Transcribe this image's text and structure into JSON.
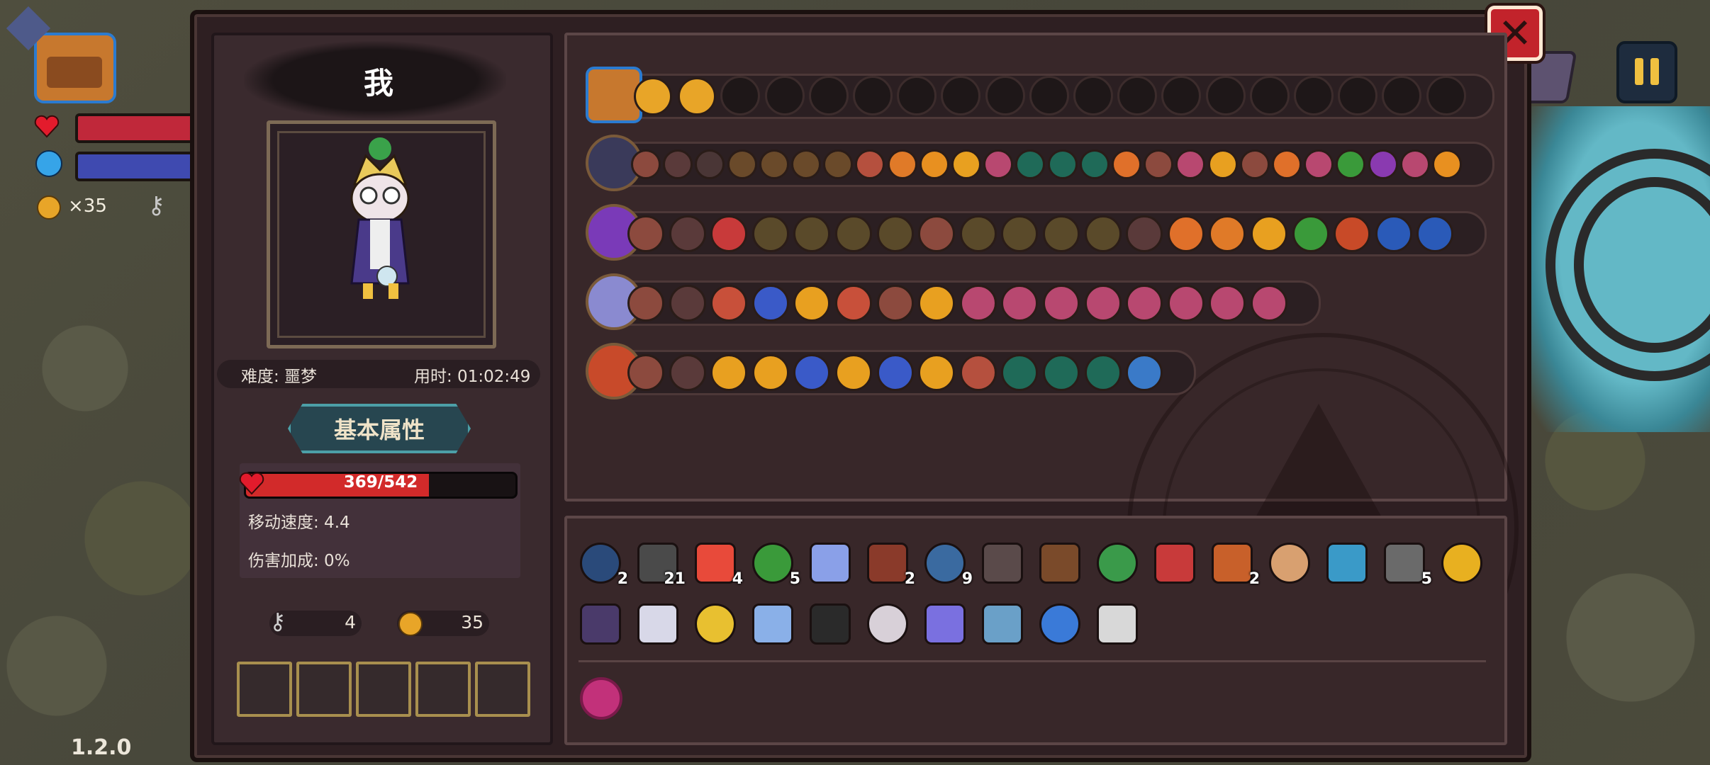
{
  "hud": {
    "coins_label": "×35",
    "version": "1.2.0"
  },
  "panel": {
    "player_name": "我",
    "difficulty": "难度: 噩梦",
    "time": "用时: 01:02:49",
    "attr_title": "基本属性",
    "hp_text": "369/542",
    "hp_fraction": 0.68,
    "move_speed": "移动速度: 4.4",
    "damage_bonus": "伤害加成: 0%",
    "keys": "4",
    "coins": "35",
    "empty_slots": 5
  },
  "colors": {
    "hp_red": "#d22a2a",
    "mp_blue": "#3f4ab0",
    "close_red": "#c2232b",
    "gold": "#f0c040",
    "panel_bg": "#2e1f22"
  },
  "weapon_rows": [
    {
      "weapon_icon": "chest-icon",
      "gems": [
        "heart-icon",
        "pause-icon"
      ],
      "empty": 17
    },
    {
      "weapon_icon": "spellbook-icon",
      "gems": [
        "fist",
        "ghost",
        "arrow",
        "fire",
        "fire",
        "fire",
        "fire",
        "crate",
        "target",
        "wing",
        "arrow-up",
        "flower",
        "emerald",
        "emerald",
        "emerald",
        "claw",
        "fist",
        "flower",
        "arrow-up",
        "fist",
        "claw",
        "flower",
        "skull",
        "lightning",
        "flower",
        "wing"
      ],
      "empty": 0
    },
    {
      "weapon_icon": "purple-staff-icon",
      "gems": [
        "fist",
        "ghost",
        "spiral",
        "signal",
        "signal",
        "signal",
        "signal",
        "fist",
        "signal",
        "signal",
        "signal",
        "signal",
        "ghost",
        "claw",
        "target",
        "arrow-up",
        "skull",
        "slash",
        "sword",
        "sword"
      ],
      "empty": 0
    },
    {
      "weapon_icon": "crystal-staff-icon",
      "gems": [
        "fist",
        "ghost",
        "burst",
        "diamond",
        "sun",
        "burst",
        "fist",
        "sun",
        "flower",
        "flower",
        "flower",
        "flower",
        "flower",
        "flower",
        "flower",
        "flower"
      ],
      "empty": 0
    },
    {
      "weapon_icon": "fire-staff-icon",
      "gems": [
        "fist",
        "ghost",
        "sun",
        "sun",
        "diamond",
        "sun",
        "diamond",
        "chevron",
        "crate",
        "emerald",
        "emerald",
        "emerald",
        "wave"
      ],
      "empty": 0
    }
  ],
  "items": [
    {
      "name": "hood-icon",
      "count": "2"
    },
    {
      "name": "arrow-icon",
      "count": "21"
    },
    {
      "name": "heart-icon",
      "count": "4"
    },
    {
      "name": "green-arrow-icon",
      "count": "5"
    },
    {
      "name": "lotus-icon",
      "count": ""
    },
    {
      "name": "crate-icon",
      "count": "2"
    },
    {
      "name": "triple-arrow-icon",
      "count": "9"
    },
    {
      "name": "hook-icon",
      "count": ""
    },
    {
      "name": "gauntlet-icon",
      "count": ""
    },
    {
      "name": "clover-icon",
      "count": ""
    },
    {
      "name": "demon-mask-icon",
      "count": ""
    },
    {
      "name": "fire-arrow-icon",
      "count": "2"
    },
    {
      "name": "ear-icon",
      "count": ""
    },
    {
      "name": "ice-arrow-icon",
      "count": ""
    },
    {
      "name": "cross-arrow-icon",
      "count": "5"
    },
    {
      "name": "golden-fist-icon",
      "count": ""
    },
    {
      "name": "cloak-icon",
      "count": ""
    },
    {
      "name": "wolf-helm-icon",
      "count": ""
    },
    {
      "name": "crown-icon",
      "count": ""
    },
    {
      "name": "crystal-heart-icon",
      "count": ""
    },
    {
      "name": "shadow-icon",
      "count": ""
    },
    {
      "name": "skull-cage-icon",
      "count": ""
    },
    {
      "name": "spring-icon",
      "count": ""
    },
    {
      "name": "magnifier-icon",
      "count": ""
    },
    {
      "name": "rainbow-cape-icon",
      "count": ""
    },
    {
      "name": "glasses-icon",
      "count": ""
    }
  ],
  "special_item": {
    "name": "pink-orb-icon"
  }
}
